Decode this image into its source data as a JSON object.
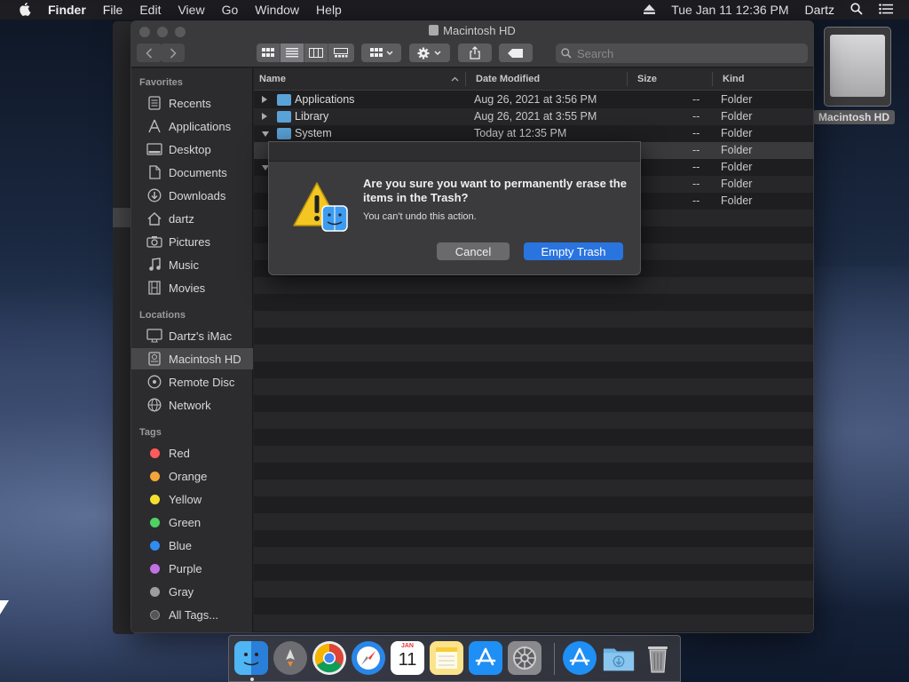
{
  "menubar": {
    "items": [
      "Finder",
      "File",
      "Edit",
      "View",
      "Go",
      "Window",
      "Help"
    ],
    "clock": "Tue Jan 11  12:36 PM",
    "user": "Dartz"
  },
  "window": {
    "title": "Macintosh HD",
    "search_placeholder": "Search"
  },
  "sidebar": {
    "favorites_heading": "Favorites",
    "favorites": [
      "Recents",
      "Applications",
      "Desktop",
      "Documents",
      "Downloads",
      "dartz",
      "Pictures",
      "Music",
      "Movies"
    ],
    "locations_heading": "Locations",
    "locations": [
      "Dartz's iMac",
      "Macintosh HD",
      "Remote Disc",
      "Network"
    ],
    "tags_heading": "Tags",
    "tags": [
      {
        "label": "Red",
        "color": "#ff5b5b"
      },
      {
        "label": "Orange",
        "color": "#f7a53a"
      },
      {
        "label": "Yellow",
        "color": "#f5e02e"
      },
      {
        "label": "Green",
        "color": "#4fd164"
      },
      {
        "label": "Blue",
        "color": "#2f8cf0"
      },
      {
        "label": "Purple",
        "color": "#c270e6"
      },
      {
        "label": "Gray",
        "color": "#9d9da0"
      }
    ],
    "all_tags": "All Tags..."
  },
  "list": {
    "headers": {
      "name": "Name",
      "date": "Date Modified",
      "size": "Size",
      "kind": "Kind"
    },
    "rows": [
      {
        "name": "Applications",
        "date": "Aug 26, 2021 at 3:56 PM",
        "size": "--",
        "kind": "Folder"
      },
      {
        "name": "Library",
        "date": "Aug 26, 2021 at 3:55 PM",
        "size": "--",
        "kind": "Folder"
      },
      {
        "name": "System",
        "date": "Today at 12:35 PM",
        "size": "--",
        "kind": "Folder"
      },
      {
        "name": "",
        "date": "",
        "size": "--",
        "kind": "Folder"
      },
      {
        "name": "",
        "date": "",
        "size": "--",
        "kind": "Folder"
      },
      {
        "name": "",
        "date": "",
        "size": "--",
        "kind": "Folder"
      },
      {
        "name": "",
        "date": "",
        "size": "--",
        "kind": "Folder"
      }
    ]
  },
  "dialog": {
    "title": "Are you sure you want to permanently erase the items in the Trash?",
    "message": "You can't undo this action.",
    "cancel": "Cancel",
    "confirm": "Empty Trash"
  },
  "desktop": {
    "icon_label": "Macintosh HD"
  },
  "dock": {
    "apps": [
      "Finder",
      "Launchpad",
      "Chrome",
      "Safari",
      "Calendar",
      "Notes",
      "App Store",
      "System Preferences",
      "App Store",
      "Downloads",
      "Trash"
    ],
    "calendar_day": "11",
    "calendar_month": "JAN"
  }
}
